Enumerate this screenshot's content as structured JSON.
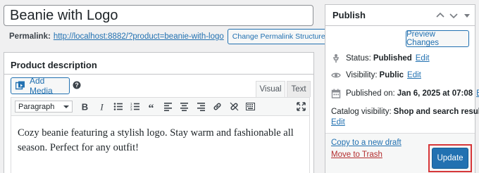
{
  "post": {
    "title": "Beanie with Logo",
    "permalink_label": "Permalink:",
    "permalink_url": "http://localhost:8882/?product=beanie-with-logo",
    "change_permalink_label": "Change Permalink Structure"
  },
  "editor": {
    "heading": "Product description",
    "add_media_label": "Add Media",
    "tabs": [
      "Visual",
      "Text"
    ],
    "format_select": "Paragraph",
    "toolbar_icons": [
      "bold-icon",
      "italic-icon",
      "bullet-list-icon",
      "numbered-list-icon",
      "blockquote-icon",
      "align-left-icon",
      "align-center-icon",
      "align-right-icon",
      "link-icon",
      "unlink-icon",
      "toolbar-toggle-icon",
      "fullscreen-icon"
    ],
    "content": "Cozy beanie featuring a stylish logo. Stay warm and fashionable all season. Perfect for any outfit!"
  },
  "publish": {
    "heading": "Publish",
    "preview_label": "Preview Changes",
    "status_label": "Status:",
    "status_value": "Published",
    "visibility_label": "Visibility:",
    "visibility_value": "Public",
    "published_label": "Published on:",
    "published_value": "Jan 6, 2025 at 07:08",
    "catalog_label": "Catalog visibility:",
    "catalog_value": "Shop and search results",
    "edit_label": "Edit",
    "copy_label": "Copy to a new draft",
    "trash_label": "Move to Trash",
    "update_label": "Update"
  },
  "colors": {
    "accent": "#2271b1",
    "danger": "#b32d2e",
    "highlight_box": "#d63638"
  }
}
